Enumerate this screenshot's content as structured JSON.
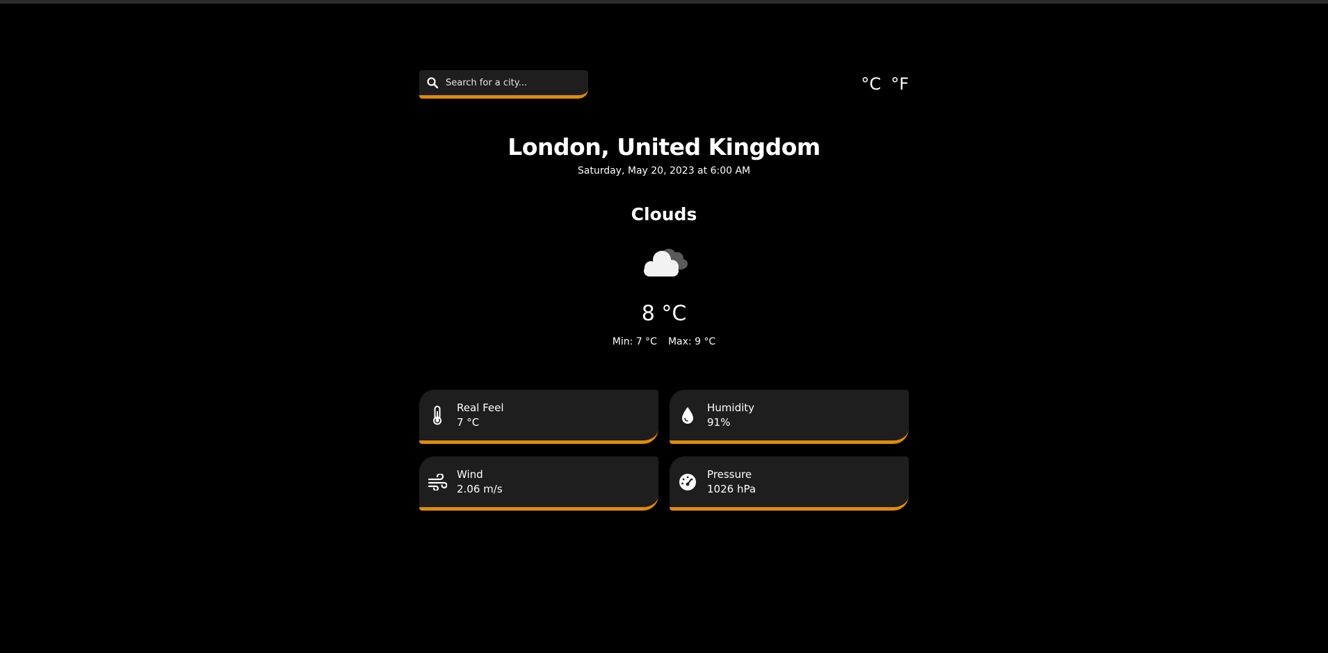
{
  "search": {
    "placeholder": "Search for a city..."
  },
  "units": {
    "celsius": "°C",
    "fahrenheit": "°F"
  },
  "location": {
    "city": "London, United Kingdom",
    "datetime": "Saturday, May 20, 2023 at 6:00 AM"
  },
  "current": {
    "condition": "Clouds",
    "icon": "clouds-icon",
    "temperature": "8 °C",
    "min": "Min: 7 °C",
    "max": "Max: 9 °C"
  },
  "details": {
    "real_feel": {
      "label": "Real Feel",
      "value": "7 °C",
      "icon": "thermometer-icon"
    },
    "humidity": {
      "label": "Humidity",
      "value": "91%",
      "icon": "water-drop-icon"
    },
    "wind": {
      "label": "Wind",
      "value": "2.06 m/s",
      "icon": "wind-icon"
    },
    "pressure": {
      "label": "Pressure",
      "value": "1026 hPa",
      "icon": "gauge-icon"
    }
  },
  "colors": {
    "background": "#000000",
    "panel": "#1e1e1e",
    "accent": "#e08a0b",
    "text": "#ffffff"
  }
}
